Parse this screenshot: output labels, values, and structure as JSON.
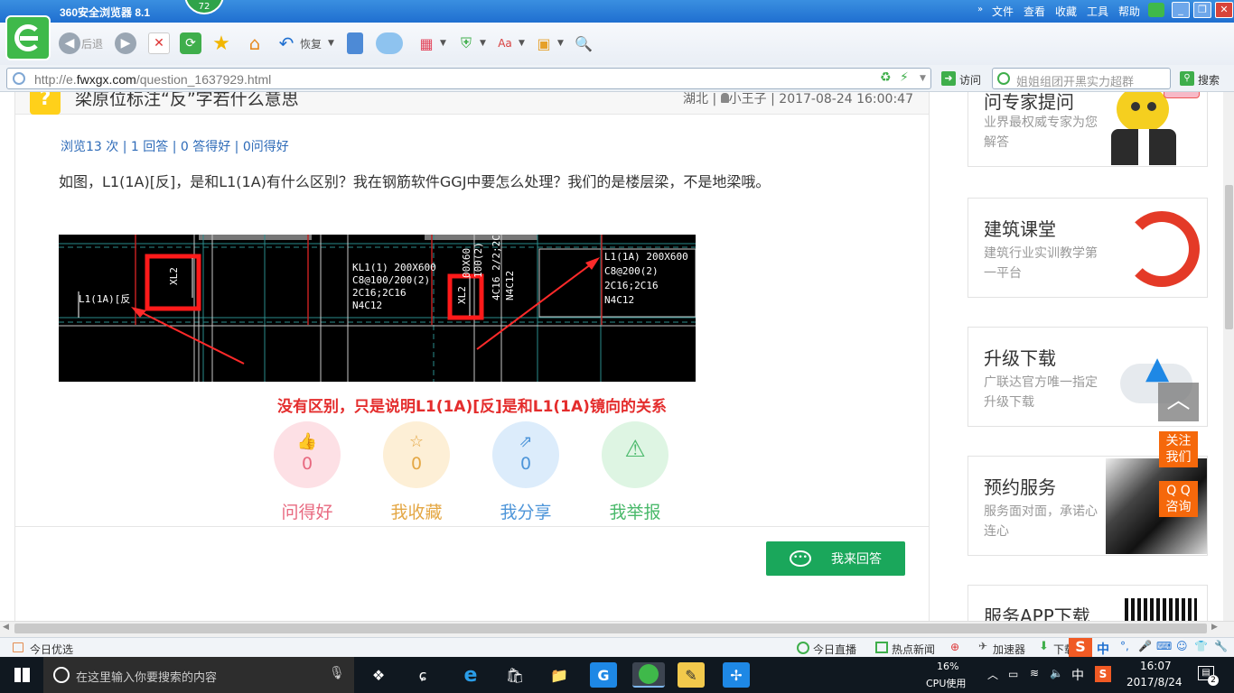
{
  "browser": {
    "title": "360安全浏览器 8.1",
    "badge": "72",
    "menu": [
      "文件",
      "查看",
      "收藏",
      "工具",
      "帮助"
    ],
    "back_label": "后退",
    "restore_label": "恢复",
    "url_prefix": "http://e.",
    "url_host": "fwxgx.com",
    "url_path": "/question_1637929.html",
    "visit_label": "访问",
    "search_placeholder": "姐姐组团开黑实力超群",
    "search_label": "搜索"
  },
  "question": {
    "title": "梁原位标注“反”字若什么意思",
    "location": "湖北",
    "author": "小王子",
    "datetime": "2017-08-24 16:00:47",
    "stats": "浏览13 次 | 1 回答 | 0 答得好 | 0问得好",
    "body": "如图，L1(1A)[反]，是和L1(1A)有什么区别？我在钢筋软件GGJ中要怎么处理？我们的是楼层梁，不是地梁哦。",
    "cad_labels": {
      "left_label": "L1(1A)[反",
      "xl2_a": "XL2",
      "xl2_b": "XL2",
      "kl1_lines": [
        "KL1(1) 200X600",
        "C8@100/200(2)",
        "2C16;2C16",
        "N4C12"
      ],
      "vertical_a": "00X60",
      "vertical_b": "100(2)",
      "vertical_c": "4C16 2/2;2C",
      "vertical_d": "N4C12",
      "l1_lines": [
        "L1(1A) 200X600",
        "C8@200(2)",
        "2C16;2C16",
        "N4C12"
      ]
    },
    "answer_text": "没有区别，只是说明L1(1A)[反]是和L1(1A)镜向的关系",
    "actions": [
      {
        "label": "问得好",
        "count": "0",
        "icon": "thumbs-up-icon",
        "color": "#e8687f",
        "bg": "#fde0e5"
      },
      {
        "label": "我收藏",
        "count": "0",
        "icon": "star-icon",
        "color": "#e4a744",
        "bg": "#fdefd6"
      },
      {
        "label": "我分享",
        "count": "0",
        "icon": "share-icon",
        "color": "#4d95d9",
        "bg": "#dcecfb"
      },
      {
        "label": "我举报",
        "count": "",
        "icon": "warning-icon",
        "color": "#49b96a",
        "bg": "#def5e3"
      }
    ],
    "answer_button": "我来回答"
  },
  "sidebar": [
    {
      "title": "问专家提问",
      "sub": "业界最权威专家为您解答",
      "icon": "mascot-icon"
    },
    {
      "title": "建筑课堂",
      "sub": "建筑行业实训教学第一平台",
      "icon": "swirl-logo-icon"
    },
    {
      "title": "升级下载",
      "sub": "广联达官方唯一指定升级下载",
      "icon": "cloud-upload-icon"
    },
    {
      "title": "预约服务",
      "sub": "服务面对面，承诺心连心",
      "icon": "handshake-icon"
    },
    {
      "title": "服务APP下载",
      "sub": "",
      "icon": "qr-code-icon"
    }
  ],
  "float": {
    "follow": [
      "关注",
      "我们"
    ],
    "qq": [
      "Q Q",
      "咨询"
    ]
  },
  "statusbar": {
    "left": "今日优选",
    "live": "今日直播",
    "news": "热点新闻",
    "accel": "加速器",
    "download": "下载"
  },
  "taskbar": {
    "search_placeholder": "在这里输入你要搜索的内容",
    "cpu_percent": "16%",
    "cpu_label": "CPU使用",
    "ime": "中",
    "time": "16:07",
    "date": "2017/8/24",
    "notifications": "2"
  }
}
